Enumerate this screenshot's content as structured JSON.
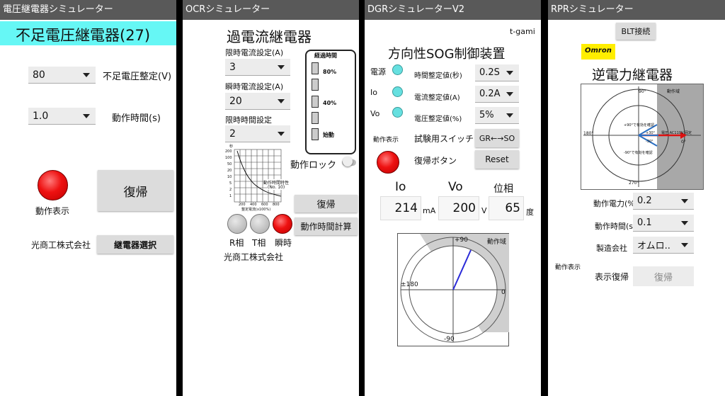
{
  "panel1": {
    "title": "電圧継電器シミュレーター",
    "header": "不足電圧継電器(27)",
    "voltage_value": "80",
    "voltage_label": "不足電圧整定(V)",
    "time_value": "1.0",
    "time_label": "動作時間(s)",
    "reset_label": "復帰",
    "indicator_label": "動作表示",
    "company": "光商工株式会社",
    "select_relay_label": "継電器選択",
    "accent": "#66f7f5"
  },
  "panel2": {
    "title": "OCRシミュレーター",
    "header": "過電流継電器",
    "limit_current_label": "限時電流設定(A)",
    "limit_current_value": "3",
    "instant_current_label": "瞬時電流設定(A)",
    "instant_current_value": "20",
    "limit_time_label": "限時時間設定",
    "limit_time_value": "2",
    "elapsed_title": "経過時間",
    "elapsed_80": "80%",
    "elapsed_40": "40%",
    "elapsed_start": "始動",
    "lock_label": "動作ロック",
    "reset_label": "復帰",
    "calc_label": "動作時間計算",
    "phase_r": "R相",
    "phase_t": "T相",
    "phase_instant": "瞬時",
    "company": "光商工株式会社",
    "chart_caption": "動作時間特性",
    "chart_sub": "(No. 10)",
    "chart_xlabel": "整定電流(x100%)",
    "chart_ylabel": "秒",
    "chart_y_ticks": [
      "200",
      "100",
      "50",
      "20",
      "10",
      "5",
      "2",
      "1"
    ],
    "chart_x_ticks": [
      "200",
      "400",
      "600",
      "800"
    ]
  },
  "panel3": {
    "title": "DGRシミュレーターV2",
    "author": "t-gami",
    "header": "方向性SOG制御装置",
    "power_label": "電源",
    "io_label": "Io",
    "vo_label": "Vo",
    "time_setting_label": "時間整定値(秒)",
    "time_setting_value": "0.2S",
    "current_setting_label": "電流整定値(A)",
    "current_setting_value": "0.2A",
    "voltage_setting_label": "電圧整定値(%)",
    "voltage_setting_value": "5%",
    "indicator_label": "動作表示",
    "test_switch_label": "試験用スイッチ",
    "test_switch_value": "GR←→SO",
    "reset_label": "復帰ボタン",
    "reset_button": "Reset",
    "io_header": "Io",
    "vo_header": "Vo",
    "phase_header": "位相",
    "io_value": "214",
    "io_unit": "mA",
    "vo_value": "200",
    "vo_unit": "V",
    "phase_value": "65",
    "phase_unit": "度",
    "dial_top": "+90",
    "dial_left": "±180",
    "dial_right": "0",
    "dial_bottom": "-90",
    "dial_zone": "動作域"
  },
  "panel4": {
    "title": "RPRシミュレーター",
    "blt_label": "BLT接続",
    "maker_badge": "Omron",
    "header": "逆電力継電器",
    "power_label": "動作電力(%)",
    "power_value": "0.2",
    "time_label": "動作時間(s)",
    "time_value": "0.1",
    "maker_label": "製造会社",
    "maker_value": "オムロ..",
    "indicator_label": "動作表示",
    "reset_label": "表示復帰",
    "reset_button": "復帰",
    "diagram_zone": "動作域",
    "diagram_top": "90°",
    "diagram_left": "180°",
    "diagram_right": "0°",
    "diagram_bottom": "270°",
    "diagram_ref": "電圧 AC110V 固定",
    "diagram_lead": "+90°で有効を確認",
    "diagram_lag": "-90°で有効を確認",
    "diagram_p30": "+30°",
    "diagram_m30": "-30°",
    "badge_color": "#ffee00"
  }
}
